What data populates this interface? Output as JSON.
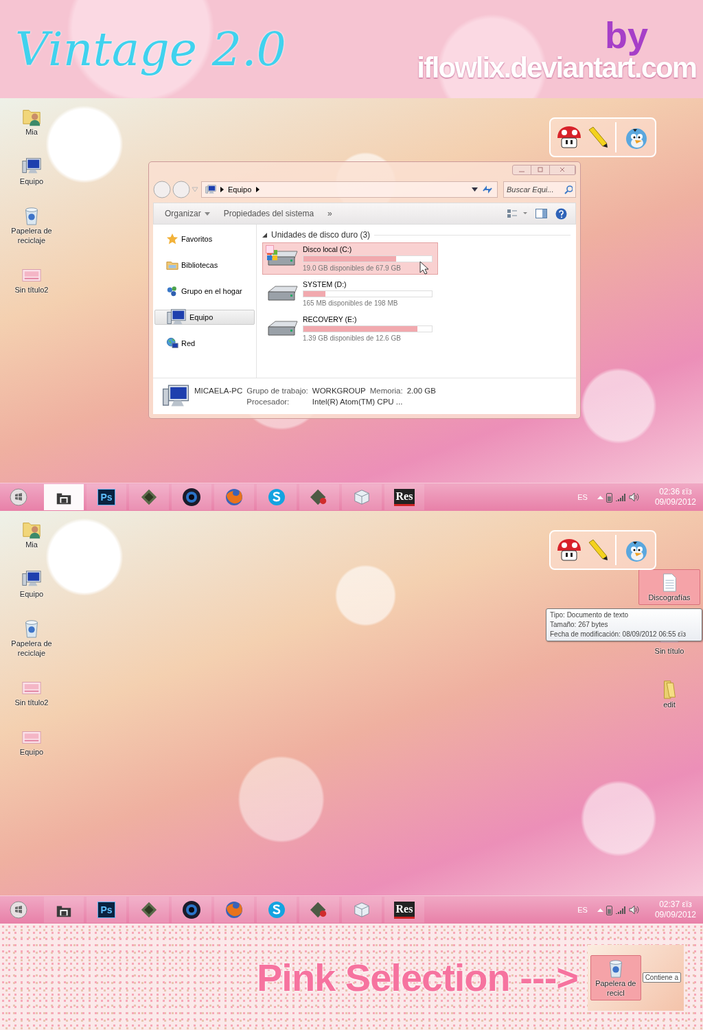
{
  "banner": {
    "title": "Vintage 2.0",
    "by": "by",
    "site": "iflowlix.deviantart.com"
  },
  "screens": [
    {
      "desktop_icons": [
        {
          "label": "Mia",
          "kind": "user-folder",
          "selected": false
        },
        {
          "label": "Equipo",
          "kind": "computer",
          "selected": false
        },
        {
          "label": "Papelera de reciclaje",
          "kind": "recycle-bin",
          "selected": false
        },
        {
          "label": "Sin título2",
          "kind": "image",
          "selected": false
        }
      ],
      "explorer": {
        "address": "Equipo",
        "search_placeholder": "Buscar Equi...",
        "toolbar": [
          {
            "label": "Organizar",
            "has_menu": true
          },
          {
            "label": "Propiedades del sistema",
            "has_menu": false
          },
          {
            "label": "»",
            "has_menu": false
          }
        ],
        "nav": [
          {
            "label": "Favoritos",
            "kind": "star",
            "selected": false
          },
          {
            "label": "Bibliotecas",
            "kind": "library",
            "selected": false
          },
          {
            "label": "Grupo en el hogar",
            "kind": "homegroup",
            "selected": false
          },
          {
            "label": "Equipo",
            "kind": "computer",
            "selected": true
          },
          {
            "label": "Red",
            "kind": "network",
            "selected": false
          }
        ],
        "section": {
          "title": "Unidades de disco duro (3)",
          "expanded": true
        },
        "drives": [
          {
            "name": "Disco local (C:)",
            "kind": "system",
            "level": 0.72,
            "free": "19.0 GB disponibles de 67.9 GB",
            "selected": true
          },
          {
            "name": "SYSTEM (D:)",
            "kind": "plain",
            "level": 0.17,
            "free": "165 MB disponibles de 198 MB",
            "selected": false
          },
          {
            "name": "RECOVERY (E:)",
            "kind": "plain",
            "level": 0.89,
            "free": "1.39 GB disponibles de 12.6 GB",
            "selected": false
          }
        ],
        "details": {
          "computer": "MICAELA-PC",
          "workgroup_label": "Grupo de trabajo:",
          "workgroup": "WORKGROUP",
          "memory_label": "Memoria:",
          "memory": "2.00 GB",
          "processor_label": "Procesador:",
          "processor": "Intel(R) Atom(TM) CPU ..."
        }
      },
      "taskbar": {
        "apps": [
          {
            "kind": "explorer",
            "selected": true
          },
          {
            "kind": "text-app",
            "label": "Ps",
            "selected": false
          },
          {
            "kind": "chip",
            "selected": false
          },
          {
            "kind": "camera",
            "selected": false
          },
          {
            "kind": "firefox",
            "selected": false
          },
          {
            "kind": "skype",
            "selected": false
          },
          {
            "kind": "tool",
            "selected": false
          },
          {
            "kind": "cube",
            "selected": false
          },
          {
            "kind": "res-app",
            "label": "Res",
            "selected": false
          }
        ],
        "tray": {
          "language": "ES",
          "time": "02:36 εїз",
          "date": "09/09/2012"
        }
      }
    },
    {
      "desktop_icons": [
        {
          "label": "Mia",
          "kind": "user-folder",
          "selected": false
        },
        {
          "label": "Equipo",
          "kind": "computer",
          "selected": false
        },
        {
          "label": "Papelera de reciclaje",
          "kind": "recycle-bin",
          "selected": false
        },
        {
          "label": "Sin título2",
          "kind": "image",
          "selected": false
        },
        {
          "label": "Equipo",
          "kind": "image",
          "selected": false
        }
      ],
      "right_icons": [
        {
          "label": "Discografías",
          "kind": "text-file",
          "selected": true
        },
        {
          "label": "Sin título",
          "kind": "image",
          "selected": false
        },
        {
          "label": "edit",
          "kind": "folder",
          "selected": false
        }
      ],
      "tooltip": {
        "lines": [
          "Tipo: Documento de texto",
          "Tamaño: 267 bytes",
          "Fecha de modificación: 08/09/2012 06:55 εїз"
        ]
      },
      "taskbar": {
        "apps": [
          {
            "kind": "explorer",
            "selected": false
          },
          {
            "kind": "text-app",
            "label": "Ps",
            "selected": false
          },
          {
            "kind": "chip",
            "selected": false
          },
          {
            "kind": "camera",
            "selected": false
          },
          {
            "kind": "firefox",
            "selected": false
          },
          {
            "kind": "skype",
            "selected": false
          },
          {
            "kind": "tool",
            "selected": false
          },
          {
            "kind": "cube",
            "selected": false
          },
          {
            "kind": "res-app",
            "label": "Res",
            "selected": false
          }
        ],
        "tray": {
          "language": "ES",
          "time": "02:37 εїз",
          "date": "09/09/2012"
        }
      }
    }
  ],
  "footer": {
    "caption": "Pink Selection --->",
    "preview": {
      "label": "Papelera de recicl",
      "kind": "recycle-bin",
      "selected": true,
      "tooltip": "Contiene a"
    }
  }
}
